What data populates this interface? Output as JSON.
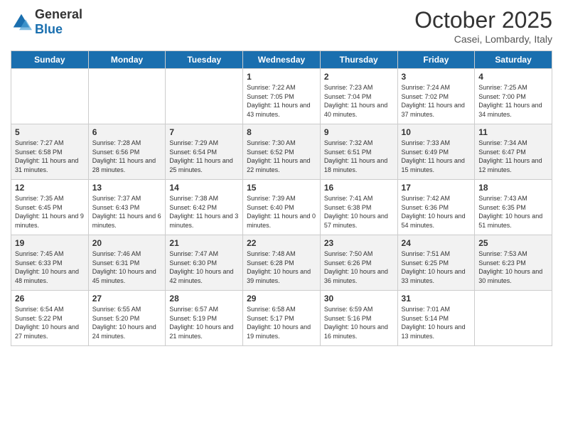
{
  "header": {
    "logo_general": "General",
    "logo_blue": "Blue",
    "month_title": "October 2025",
    "location": "Casei, Lombardy, Italy"
  },
  "weekdays": [
    "Sunday",
    "Monday",
    "Tuesday",
    "Wednesday",
    "Thursday",
    "Friday",
    "Saturday"
  ],
  "weeks": [
    [
      null,
      null,
      null,
      {
        "day": "1",
        "sunrise": "7:22 AM",
        "sunset": "7:05 PM",
        "daylight": "11 hours and 43 minutes."
      },
      {
        "day": "2",
        "sunrise": "7:23 AM",
        "sunset": "7:04 PM",
        "daylight": "11 hours and 40 minutes."
      },
      {
        "day": "3",
        "sunrise": "7:24 AM",
        "sunset": "7:02 PM",
        "daylight": "11 hours and 37 minutes."
      },
      {
        "day": "4",
        "sunrise": "7:25 AM",
        "sunset": "7:00 PM",
        "daylight": "11 hours and 34 minutes."
      }
    ],
    [
      {
        "day": "5",
        "sunrise": "7:27 AM",
        "sunset": "6:58 PM",
        "daylight": "11 hours and 31 minutes."
      },
      {
        "day": "6",
        "sunrise": "7:28 AM",
        "sunset": "6:56 PM",
        "daylight": "11 hours and 28 minutes."
      },
      {
        "day": "7",
        "sunrise": "7:29 AM",
        "sunset": "6:54 PM",
        "daylight": "11 hours and 25 minutes."
      },
      {
        "day": "8",
        "sunrise": "7:30 AM",
        "sunset": "6:52 PM",
        "daylight": "11 hours and 22 minutes."
      },
      {
        "day": "9",
        "sunrise": "7:32 AM",
        "sunset": "6:51 PM",
        "daylight": "11 hours and 18 minutes."
      },
      {
        "day": "10",
        "sunrise": "7:33 AM",
        "sunset": "6:49 PM",
        "daylight": "11 hours and 15 minutes."
      },
      {
        "day": "11",
        "sunrise": "7:34 AM",
        "sunset": "6:47 PM",
        "daylight": "11 hours and 12 minutes."
      }
    ],
    [
      {
        "day": "12",
        "sunrise": "7:35 AM",
        "sunset": "6:45 PM",
        "daylight": "11 hours and 9 minutes."
      },
      {
        "day": "13",
        "sunrise": "7:37 AM",
        "sunset": "6:43 PM",
        "daylight": "11 hours and 6 minutes."
      },
      {
        "day": "14",
        "sunrise": "7:38 AM",
        "sunset": "6:42 PM",
        "daylight": "11 hours and 3 minutes."
      },
      {
        "day": "15",
        "sunrise": "7:39 AM",
        "sunset": "6:40 PM",
        "daylight": "11 hours and 0 minutes."
      },
      {
        "day": "16",
        "sunrise": "7:41 AM",
        "sunset": "6:38 PM",
        "daylight": "10 hours and 57 minutes."
      },
      {
        "day": "17",
        "sunrise": "7:42 AM",
        "sunset": "6:36 PM",
        "daylight": "10 hours and 54 minutes."
      },
      {
        "day": "18",
        "sunrise": "7:43 AM",
        "sunset": "6:35 PM",
        "daylight": "10 hours and 51 minutes."
      }
    ],
    [
      {
        "day": "19",
        "sunrise": "7:45 AM",
        "sunset": "6:33 PM",
        "daylight": "10 hours and 48 minutes."
      },
      {
        "day": "20",
        "sunrise": "7:46 AM",
        "sunset": "6:31 PM",
        "daylight": "10 hours and 45 minutes."
      },
      {
        "day": "21",
        "sunrise": "7:47 AM",
        "sunset": "6:30 PM",
        "daylight": "10 hours and 42 minutes."
      },
      {
        "day": "22",
        "sunrise": "7:48 AM",
        "sunset": "6:28 PM",
        "daylight": "10 hours and 39 minutes."
      },
      {
        "day": "23",
        "sunrise": "7:50 AM",
        "sunset": "6:26 PM",
        "daylight": "10 hours and 36 minutes."
      },
      {
        "day": "24",
        "sunrise": "7:51 AM",
        "sunset": "6:25 PM",
        "daylight": "10 hours and 33 minutes."
      },
      {
        "day": "25",
        "sunrise": "7:53 AM",
        "sunset": "6:23 PM",
        "daylight": "10 hours and 30 minutes."
      }
    ],
    [
      {
        "day": "26",
        "sunrise": "6:54 AM",
        "sunset": "5:22 PM",
        "daylight": "10 hours and 27 minutes."
      },
      {
        "day": "27",
        "sunrise": "6:55 AM",
        "sunset": "5:20 PM",
        "daylight": "10 hours and 24 minutes."
      },
      {
        "day": "28",
        "sunrise": "6:57 AM",
        "sunset": "5:19 PM",
        "daylight": "10 hours and 21 minutes."
      },
      {
        "day": "29",
        "sunrise": "6:58 AM",
        "sunset": "5:17 PM",
        "daylight": "10 hours and 19 minutes."
      },
      {
        "day": "30",
        "sunrise": "6:59 AM",
        "sunset": "5:16 PM",
        "daylight": "10 hours and 16 minutes."
      },
      {
        "day": "31",
        "sunrise": "7:01 AM",
        "sunset": "5:14 PM",
        "daylight": "10 hours and 13 minutes."
      },
      null
    ]
  ]
}
